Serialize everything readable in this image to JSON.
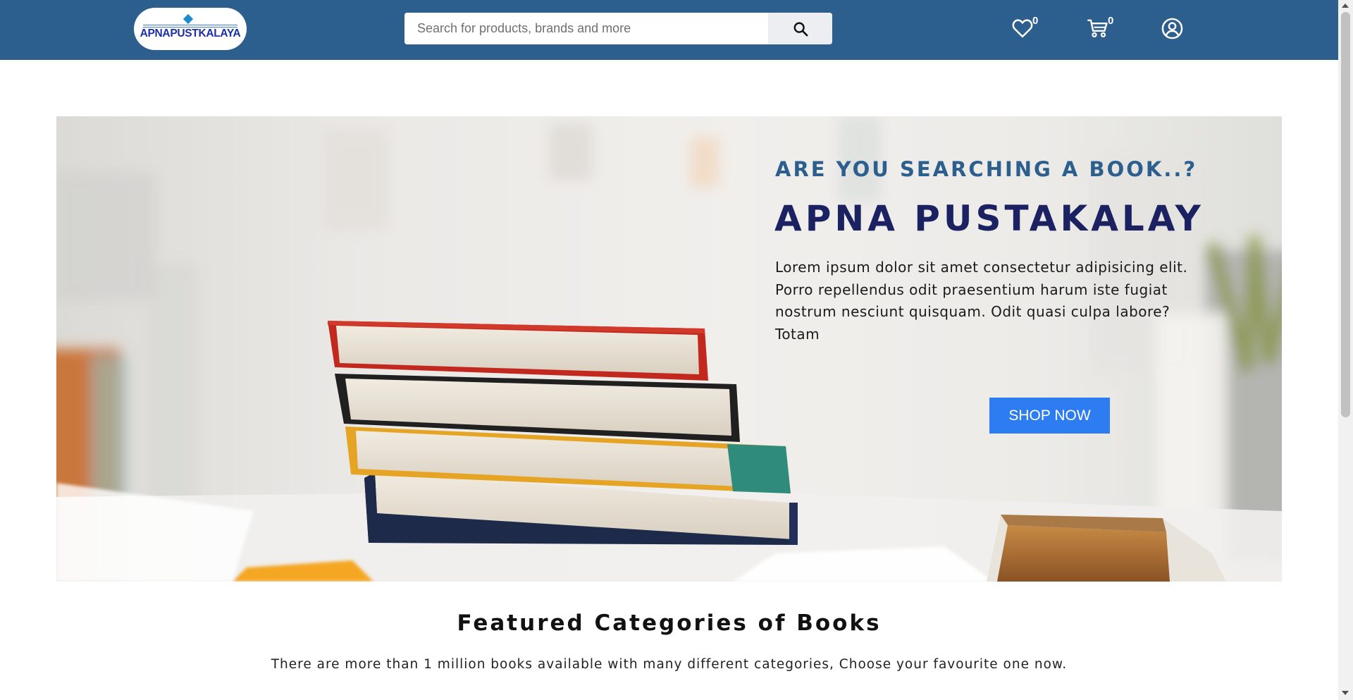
{
  "header": {
    "logo_text": "APNAPUSTKALAYA",
    "search": {
      "placeholder": "Search for products, brands and more",
      "value": ""
    },
    "wishlist_count": "0",
    "cart_count": "0",
    "icons": [
      "search-icon",
      "heart-icon",
      "cart-icon",
      "user-icon"
    ]
  },
  "hero": {
    "subtitle": "ARE YOU SEARCHING A BOOK..?",
    "title": "APNA PUSTAKALAY",
    "description": "Lorem ipsum dolor sit amet consectetur adipisicing elit. Porro repellendus odit praesentium harum iste fugiat nostrum nesciunt quisquam. Odit quasi culpa labore? Totam",
    "button_label": "SHOP NOW"
  },
  "featured": {
    "title": "Featured Categories of Books",
    "description": "There are more than 1 million books available with many different categories, Choose your favourite one now."
  },
  "colors": {
    "header_bg": "#2c5f8d",
    "subtitle": "#2c5f8d",
    "title": "#1b2161",
    "button": "#2d7cf1"
  }
}
